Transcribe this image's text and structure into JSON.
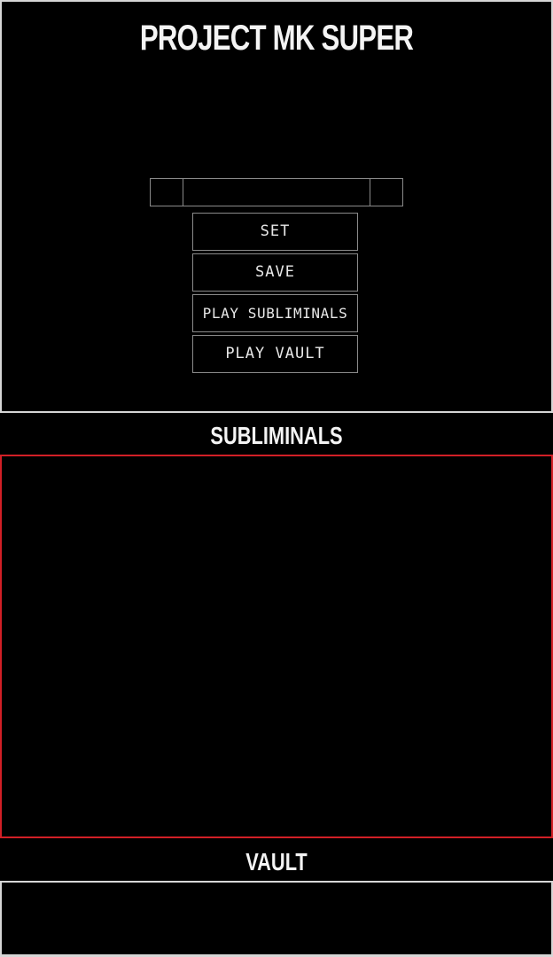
{
  "app": {
    "title": "PROJECT MK SUPER"
  },
  "controls": {
    "stepper_value": "",
    "set_label": "SET",
    "save_label": "SAVE",
    "play_subliminals_label": "PLAY SUBLIMINALS",
    "play_vault_label": "PLAY VAULT"
  },
  "sections": {
    "subliminals_title": "SUBLIMINALS",
    "vault_title": "VAULT"
  },
  "colors": {
    "background": "#000000",
    "text": "#f4f4f4",
    "border": "#8a8a8a",
    "panel_border": "#d6d6d6",
    "subliminals_border": "#d21f26"
  }
}
